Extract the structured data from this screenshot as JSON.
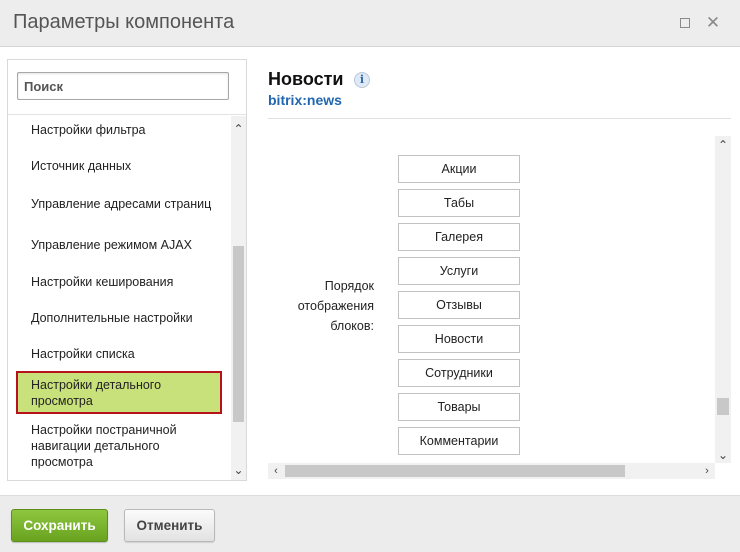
{
  "window": {
    "title": "Параметры компонента"
  },
  "search": {
    "placeholder": "Поиск"
  },
  "sidebar": {
    "items": [
      {
        "label": "Настройки фильтра"
      },
      {
        "label": "Источник данных"
      },
      {
        "label": "Управление адресами страниц"
      },
      {
        "label": "Управление режимом AJAX"
      },
      {
        "label": "Настройки кеширования"
      },
      {
        "label": "Дополнительные настройки"
      },
      {
        "label": "Настройки списка"
      },
      {
        "label": "Настройки детального просмотра",
        "active": true
      },
      {
        "label": "Настройки постраничной навигации детального просмотра"
      }
    ]
  },
  "component": {
    "name": "Новости",
    "code": "bitrix:news",
    "info_icon": "i"
  },
  "field": {
    "label": "Порядок отображения блоков:",
    "blocks": [
      "Акции",
      "Табы",
      "Галерея",
      "Услуги",
      "Отзывы",
      "Новости",
      "Сотрудники",
      "Товары",
      "Комментарии"
    ]
  },
  "footer": {
    "save_label": "Сохранить",
    "cancel_label": "Отменить"
  },
  "colors": {
    "active_item_bg": "#c9e17a",
    "active_item_border": "#b5121b",
    "save_button": "#7cb72e",
    "link": "#2067b0"
  }
}
